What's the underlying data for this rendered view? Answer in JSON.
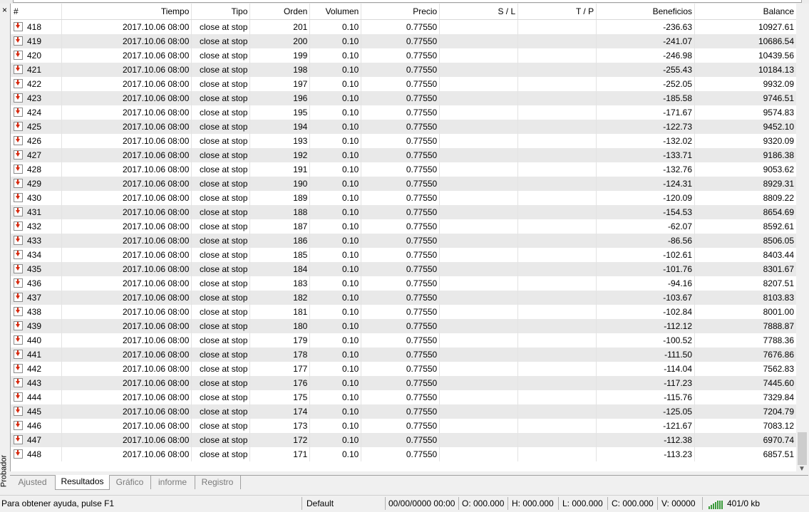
{
  "panel": {
    "close_glyph": "×",
    "vertical_title": "Probador"
  },
  "columns": [
    "#",
    "Tiempo",
    "Tipo",
    "Orden",
    "Volumen",
    "Precio",
    "S / L",
    "T / P",
    "Beneficios",
    "Balance"
  ],
  "rows": [
    [
      "418",
      "2017.10.06 08:00",
      "close at stop",
      "201",
      "0.10",
      "0.77550",
      "",
      "",
      "-236.63",
      "10927.61"
    ],
    [
      "419",
      "2017.10.06 08:00",
      "close at stop",
      "200",
      "0.10",
      "0.77550",
      "",
      "",
      "-241.07",
      "10686.54"
    ],
    [
      "420",
      "2017.10.06 08:00",
      "close at stop",
      "199",
      "0.10",
      "0.77550",
      "",
      "",
      "-246.98",
      "10439.56"
    ],
    [
      "421",
      "2017.10.06 08:00",
      "close at stop",
      "198",
      "0.10",
      "0.77550",
      "",
      "",
      "-255.43",
      "10184.13"
    ],
    [
      "422",
      "2017.10.06 08:00",
      "close at stop",
      "197",
      "0.10",
      "0.77550",
      "",
      "",
      "-252.05",
      "9932.09"
    ],
    [
      "423",
      "2017.10.06 08:00",
      "close at stop",
      "196",
      "0.10",
      "0.77550",
      "",
      "",
      "-185.58",
      "9746.51"
    ],
    [
      "424",
      "2017.10.06 08:00",
      "close at stop",
      "195",
      "0.10",
      "0.77550",
      "",
      "",
      "-171.67",
      "9574.83"
    ],
    [
      "425",
      "2017.10.06 08:00",
      "close at stop",
      "194",
      "0.10",
      "0.77550",
      "",
      "",
      "-122.73",
      "9452.10"
    ],
    [
      "426",
      "2017.10.06 08:00",
      "close at stop",
      "193",
      "0.10",
      "0.77550",
      "",
      "",
      "-132.02",
      "9320.09"
    ],
    [
      "427",
      "2017.10.06 08:00",
      "close at stop",
      "192",
      "0.10",
      "0.77550",
      "",
      "",
      "-133.71",
      "9186.38"
    ],
    [
      "428",
      "2017.10.06 08:00",
      "close at stop",
      "191",
      "0.10",
      "0.77550",
      "",
      "",
      "-132.76",
      "9053.62"
    ],
    [
      "429",
      "2017.10.06 08:00",
      "close at stop",
      "190",
      "0.10",
      "0.77550",
      "",
      "",
      "-124.31",
      "8929.31"
    ],
    [
      "430",
      "2017.10.06 08:00",
      "close at stop",
      "189",
      "0.10",
      "0.77550",
      "",
      "",
      "-120.09",
      "8809.22"
    ],
    [
      "431",
      "2017.10.06 08:00",
      "close at stop",
      "188",
      "0.10",
      "0.77550",
      "",
      "",
      "-154.53",
      "8654.69"
    ],
    [
      "432",
      "2017.10.06 08:00",
      "close at stop",
      "187",
      "0.10",
      "0.77550",
      "",
      "",
      "-62.07",
      "8592.61"
    ],
    [
      "433",
      "2017.10.06 08:00",
      "close at stop",
      "186",
      "0.10",
      "0.77550",
      "",
      "",
      "-86.56",
      "8506.05"
    ],
    [
      "434",
      "2017.10.06 08:00",
      "close at stop",
      "185",
      "0.10",
      "0.77550",
      "",
      "",
      "-102.61",
      "8403.44"
    ],
    [
      "435",
      "2017.10.06 08:00",
      "close at stop",
      "184",
      "0.10",
      "0.77550",
      "",
      "",
      "-101.76",
      "8301.67"
    ],
    [
      "436",
      "2017.10.06 08:00",
      "close at stop",
      "183",
      "0.10",
      "0.77550",
      "",
      "",
      "-94.16",
      "8207.51"
    ],
    [
      "437",
      "2017.10.06 08:00",
      "close at stop",
      "182",
      "0.10",
      "0.77550",
      "",
      "",
      "-103.67",
      "8103.83"
    ],
    [
      "438",
      "2017.10.06 08:00",
      "close at stop",
      "181",
      "0.10",
      "0.77550",
      "",
      "",
      "-102.84",
      "8001.00"
    ],
    [
      "439",
      "2017.10.06 08:00",
      "close at stop",
      "180",
      "0.10",
      "0.77550",
      "",
      "",
      "-112.12",
      "7888.87"
    ],
    [
      "440",
      "2017.10.06 08:00",
      "close at stop",
      "179",
      "0.10",
      "0.77550",
      "",
      "",
      "-100.52",
      "7788.36"
    ],
    [
      "441",
      "2017.10.06 08:00",
      "close at stop",
      "178",
      "0.10",
      "0.77550",
      "",
      "",
      "-111.50",
      "7676.86"
    ],
    [
      "442",
      "2017.10.06 08:00",
      "close at stop",
      "177",
      "0.10",
      "0.77550",
      "",
      "",
      "-114.04",
      "7562.83"
    ],
    [
      "443",
      "2017.10.06 08:00",
      "close at stop",
      "176",
      "0.10",
      "0.77550",
      "",
      "",
      "-117.23",
      "7445.60"
    ],
    [
      "444",
      "2017.10.06 08:00",
      "close at stop",
      "175",
      "0.10",
      "0.77550",
      "",
      "",
      "-115.76",
      "7329.84"
    ],
    [
      "445",
      "2017.10.06 08:00",
      "close at stop",
      "174",
      "0.10",
      "0.77550",
      "",
      "",
      "-125.05",
      "7204.79"
    ],
    [
      "446",
      "2017.10.06 08:00",
      "close at stop",
      "173",
      "0.10",
      "0.77550",
      "",
      "",
      "-121.67",
      "7083.12"
    ],
    [
      "447",
      "2017.10.06 08:00",
      "close at stop",
      "172",
      "0.10",
      "0.77550",
      "",
      "",
      "-112.38",
      "6970.74"
    ],
    [
      "448",
      "2017.10.06 08:00",
      "close at stop",
      "171",
      "0.10",
      "0.77550",
      "",
      "",
      "-113.23",
      "6857.51"
    ]
  ],
  "row_icon": "sell-stop-arrow-icon",
  "tabs": [
    {
      "label": "Ajusted",
      "active": false
    },
    {
      "label": "Resultados",
      "active": true
    },
    {
      "label": "Gráfico",
      "active": false
    },
    {
      "label": "informe",
      "active": false
    },
    {
      "label": "Registro",
      "active": false
    }
  ],
  "statusbar": {
    "help": "Para obtener ayuda, pulse F1",
    "profile": "Default",
    "datetime": "00/00/0000 00:00",
    "open": "O: 000.000",
    "high": "H: 000.000",
    "low": "L: 000.000",
    "close": "C: 000.000",
    "volume": "V: 00000",
    "traffic": "401/0 kb"
  },
  "colors": {
    "row_alt": "#e9e9e9",
    "icon_arrow": "#d62a10",
    "traffic_bars": "#3a9a3a"
  }
}
